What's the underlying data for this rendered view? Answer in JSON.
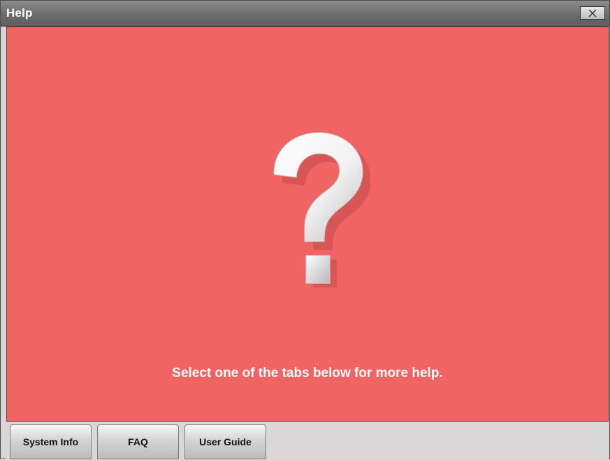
{
  "window": {
    "title": "Help",
    "close_icon": "close-x-icon"
  },
  "main": {
    "background_color": "#f06463",
    "center_icon": "question-mark-icon",
    "message": "Select one of the tabs below for more help."
  },
  "tabs": [
    {
      "label": "System Info"
    },
    {
      "label": "FAQ"
    },
    {
      "label": "User Guide"
    }
  ]
}
